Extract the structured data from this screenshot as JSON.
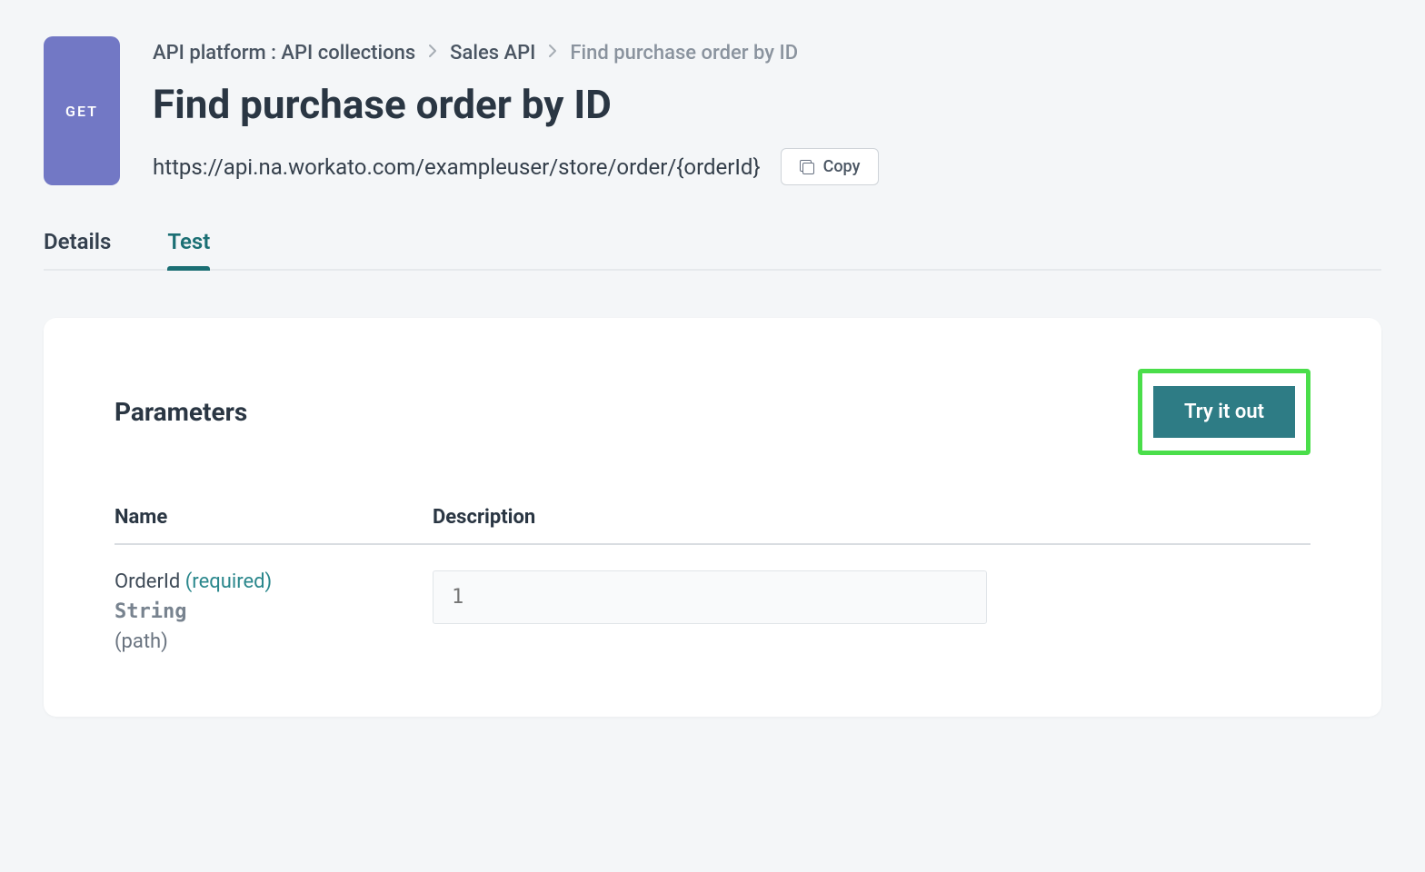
{
  "header": {
    "method": "GET",
    "breadcrumb": {
      "root": "API platform : API collections",
      "mid": "Sales API",
      "current": "Find purchase order by ID"
    },
    "title": "Find purchase order by ID",
    "url": "https://api.na.workato.com/exampleuser/store/order/{orderId}",
    "copy_label": "Copy"
  },
  "tabs": {
    "details": "Details",
    "test": "Test"
  },
  "parameters": {
    "section_title": "Parameters",
    "try_label": "Try it out",
    "columns": {
      "name": "Name",
      "description": "Description"
    },
    "items": [
      {
        "name": "OrderId",
        "required_label": "(required)",
        "type": "String",
        "location": "(path)",
        "placeholder": "1"
      }
    ]
  }
}
